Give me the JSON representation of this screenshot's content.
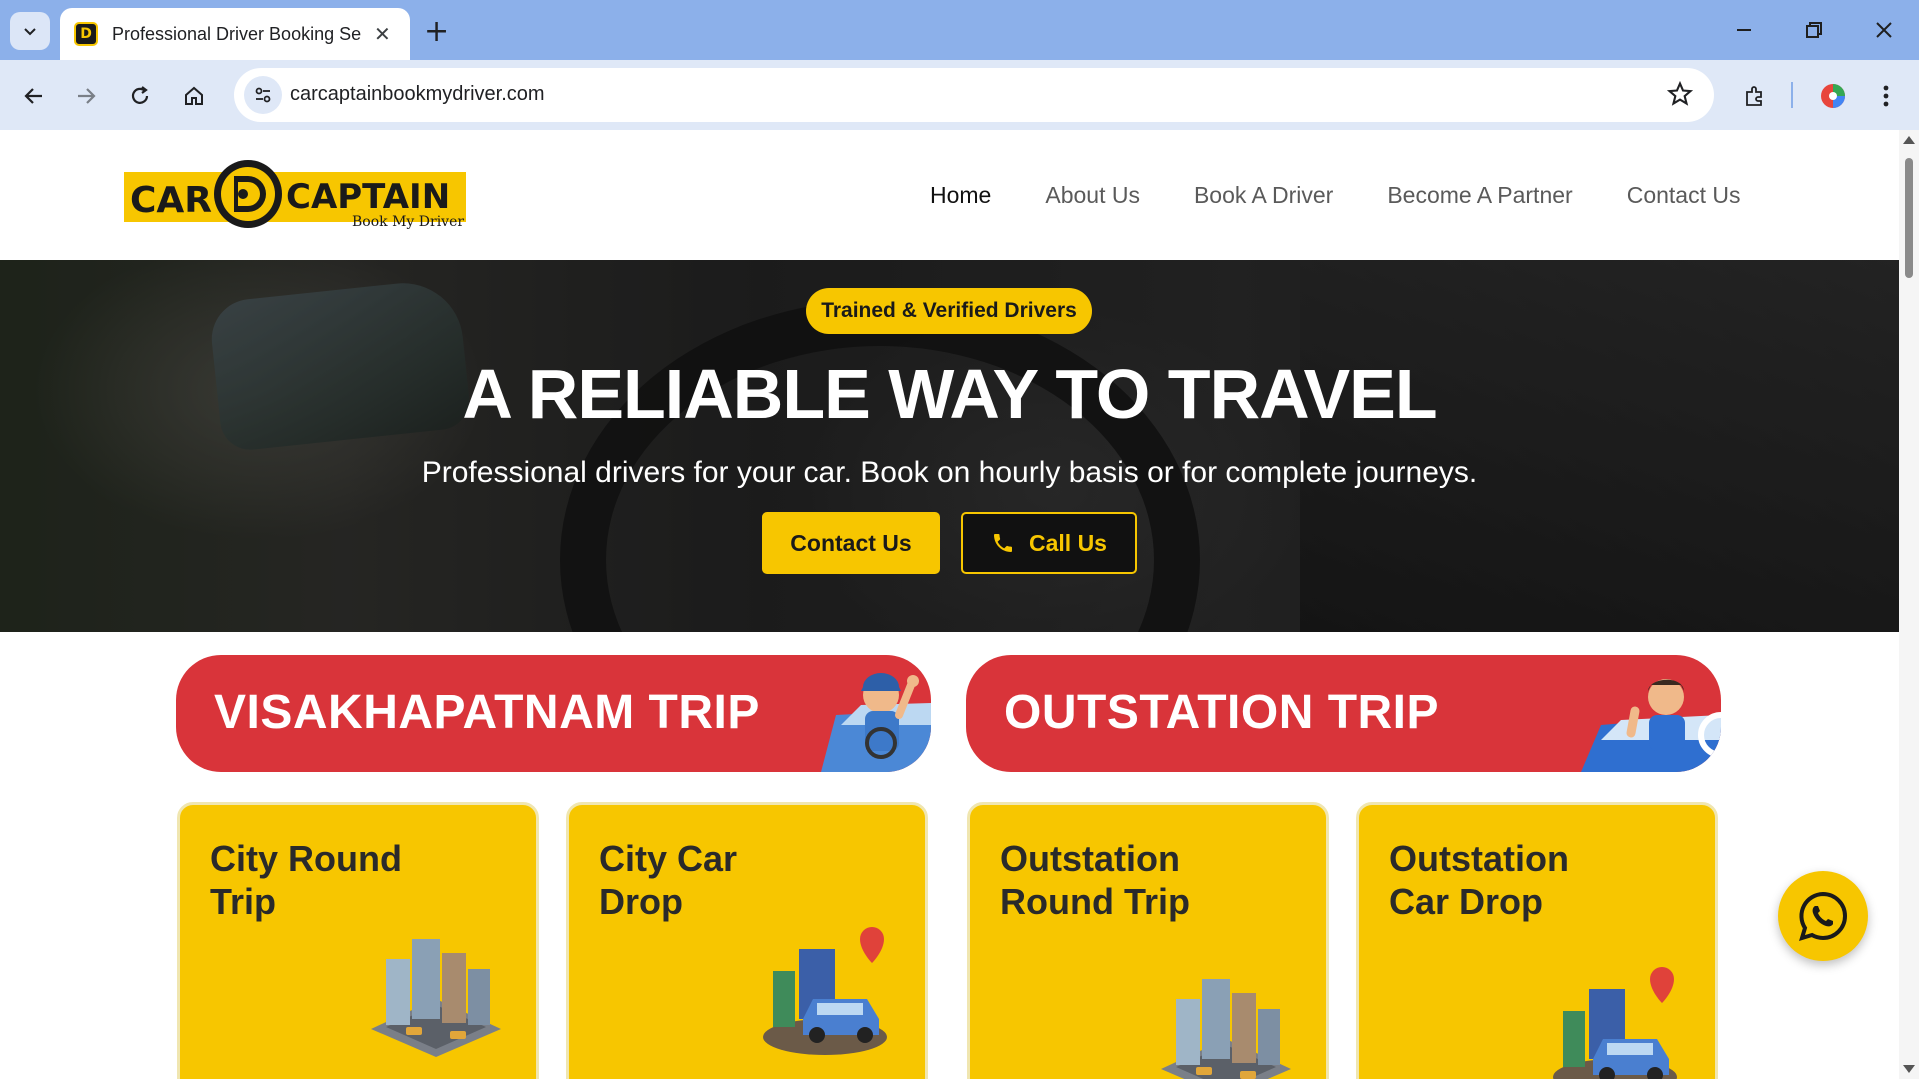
{
  "browser": {
    "tab_title": "Professional Driver Booking Ser",
    "url": "carcaptainbookmydriver.com"
  },
  "site": {
    "logo": {
      "brand_left": "CAR",
      "brand_right": "CAPTAIN",
      "tagline": "Book My Driver"
    },
    "nav": [
      {
        "label": "Home"
      },
      {
        "label": "About Us"
      },
      {
        "label": "Book A Driver"
      },
      {
        "label": "Become A Partner"
      },
      {
        "label": "Contact Us"
      }
    ]
  },
  "hero": {
    "badge": "Trained & Verified Drivers",
    "title": "A RELIABLE WAY TO TRAVEL",
    "subtitle": "Professional drivers for your car. Book on hourly basis or for complete journeys.",
    "contact_label": "Contact Us",
    "call_label": "Call Us"
  },
  "trips": [
    {
      "label": "VISAKHAPATNAM TRIP"
    },
    {
      "label": "OUTSTATION TRIP"
    }
  ],
  "cards": [
    {
      "title": "City Round Trip"
    },
    {
      "title": "City Car Drop"
    },
    {
      "title": "Outstation Round Trip"
    },
    {
      "title": "Outstation Car Drop"
    }
  ],
  "colors": {
    "accent_yellow": "#f7c600",
    "banner_red": "#d9343a",
    "chrome_blue": "#8cb0ea"
  },
  "icons": {
    "whatsapp": "whatsapp-icon",
    "phone": "phone-icon"
  }
}
